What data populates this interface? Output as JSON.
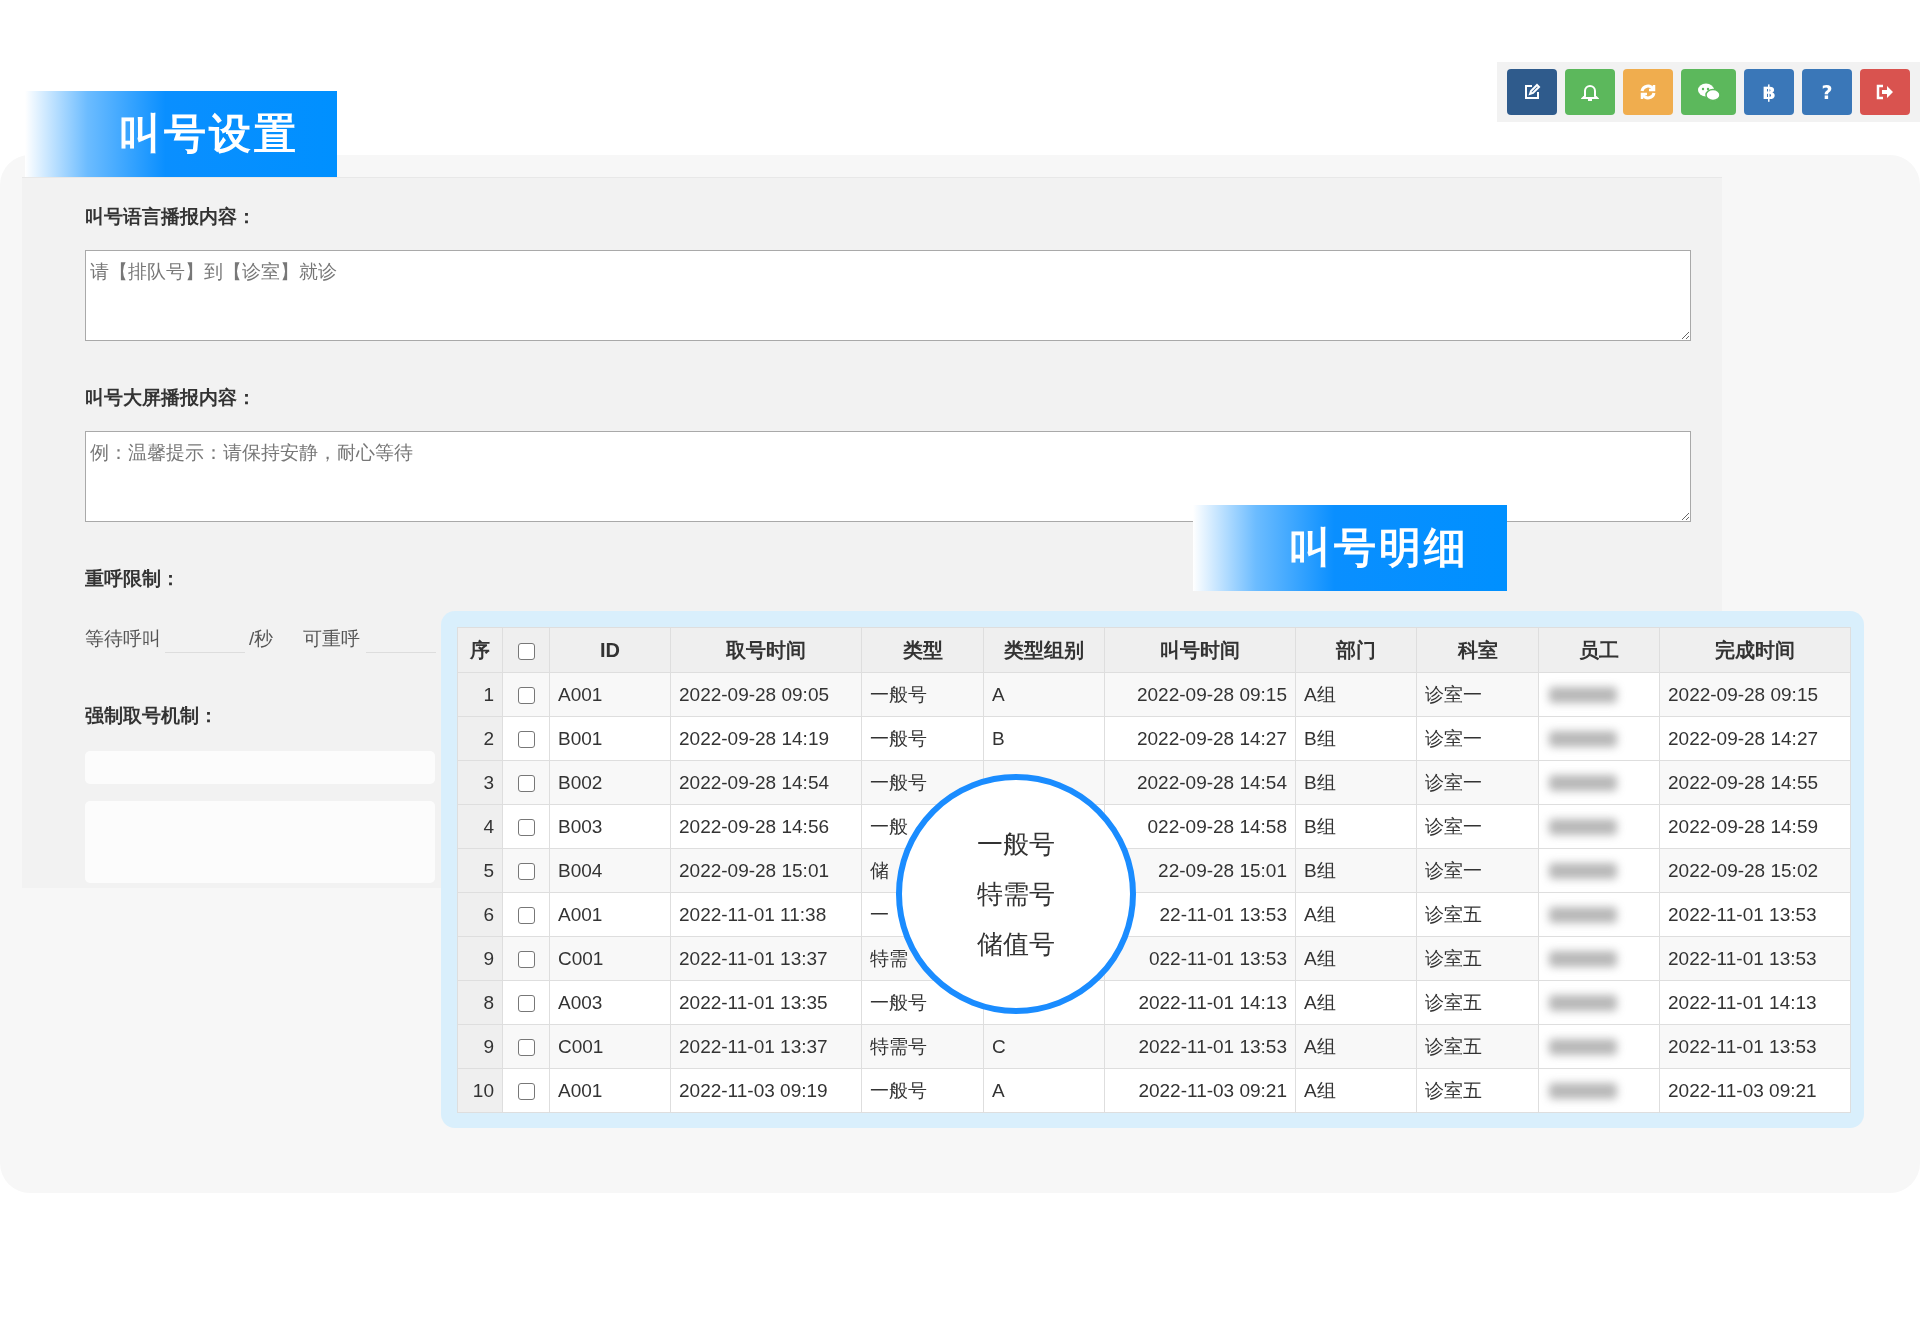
{
  "toolbar": {
    "buttons": [
      {
        "kind": "edit",
        "color": "#2f5b8c"
      },
      {
        "kind": "bell",
        "color": "#5cb85c"
      },
      {
        "kind": "refresh",
        "color": "#f0ad4e"
      },
      {
        "kind": "chat",
        "color": "#5cb85c"
      },
      {
        "kind": "char",
        "icon": "฿",
        "color": "#3a77b8"
      },
      {
        "kind": "char",
        "icon": "?",
        "color": "#3a77b8"
      },
      {
        "kind": "logout",
        "color": "#d9534f"
      }
    ]
  },
  "settings": {
    "title": "叫号设置",
    "fields": [
      {
        "label": "叫号语言播报内容：",
        "placeholder": "请【排队号】到【诊室】就诊"
      },
      {
        "label": "叫号大屏播报内容：",
        "placeholder": "例：温馨提示：请保持安静，耐心等待"
      }
    ],
    "recall_limit": {
      "label": "重呼限制：",
      "prefix": "等待呼叫",
      "unit": "/秒",
      "suffix": "可重呼"
    },
    "force": {
      "label": "强制取号机制："
    }
  },
  "details": {
    "title": "叫号明细",
    "columns": [
      "序",
      "ID",
      "取号时间",
      "类型",
      "类型组别",
      "叫号时间",
      "部门",
      "科室",
      "员工",
      "完成时间"
    ],
    "header_checkbox": {
      "checked": false
    },
    "rows": [
      {
        "no": "1",
        "checked": false,
        "id": "A001",
        "take_time": "2022-09-28 09:05",
        "type": "一般号",
        "group": "A",
        "call_time": "2022-09-28 09:15",
        "dept": "A组",
        "room": "诊室一",
        "finish_time": "2022-09-28 09:15"
      },
      {
        "no": "2",
        "checked": false,
        "id": "B001",
        "take_time": "2022-09-28 14:19",
        "type": "一般号",
        "group": "B",
        "call_time": "2022-09-28 14:27",
        "dept": "B组",
        "room": "诊室一",
        "finish_time": "2022-09-28 14:27"
      },
      {
        "no": "3",
        "checked": false,
        "id": "B002",
        "take_time": "2022-09-28 14:54",
        "type": "一般号",
        "call_time": "2022-09-28 14:54",
        "dept": "B组",
        "room": "诊室一",
        "finish_time": "2022-09-28 14:55"
      },
      {
        "no": "4",
        "checked": false,
        "id": "B003",
        "take_time": "2022-09-28 14:56",
        "type": "一般",
        "call_time": "022-09-28 14:58",
        "dept": "B组",
        "room": "诊室一",
        "finish_time": "2022-09-28 14:59"
      },
      {
        "no": "5",
        "checked": false,
        "id": "B004",
        "take_time": "2022-09-28 15:01",
        "type": "储",
        "call_time": "22-09-28 15:01",
        "dept": "B组",
        "room": "诊室一",
        "finish_time": "2022-09-28 15:02"
      },
      {
        "no": "6",
        "checked": false,
        "id": "A001",
        "take_time": "2022-11-01 11:38",
        "type": "一",
        "call_time": "22-11-01 13:53",
        "dept": "A组",
        "room": "诊室五",
        "finish_time": "2022-11-01 13:53"
      },
      {
        "no": "9",
        "checked": false,
        "id": "C001",
        "take_time": "2022-11-01 13:37",
        "type": "特需",
        "call_time": "022-11-01 13:53",
        "dept": "A组",
        "room": "诊室五",
        "finish_time": "2022-11-01 13:53"
      },
      {
        "no": "8",
        "checked": false,
        "id": "A003",
        "take_time": "2022-11-01 13:35",
        "type": "一般号",
        "call_time": "2022-11-01 14:13",
        "dept": "A组",
        "room": "诊室五",
        "finish_time": "2022-11-01 14:13"
      },
      {
        "no": "9",
        "checked": false,
        "id": "C001",
        "take_time": "2022-11-01 13:37",
        "type": "特需号",
        "group": "C",
        "call_time": "2022-11-01 13:53",
        "dept": "A组",
        "room": "诊室五",
        "finish_time": "2022-11-01 13:53"
      },
      {
        "no": "10",
        "checked": false,
        "id": "A001",
        "take_time": "2022-11-03 09:19",
        "type": "一般号",
        "group": "A",
        "call_time": "2022-11-03 09:21",
        "dept": "A组",
        "room": "诊室五",
        "finish_time": "2022-11-03 09:21"
      }
    ],
    "type_popup": {
      "options": [
        "一般号",
        "特需号",
        "储值号"
      ]
    }
  }
}
